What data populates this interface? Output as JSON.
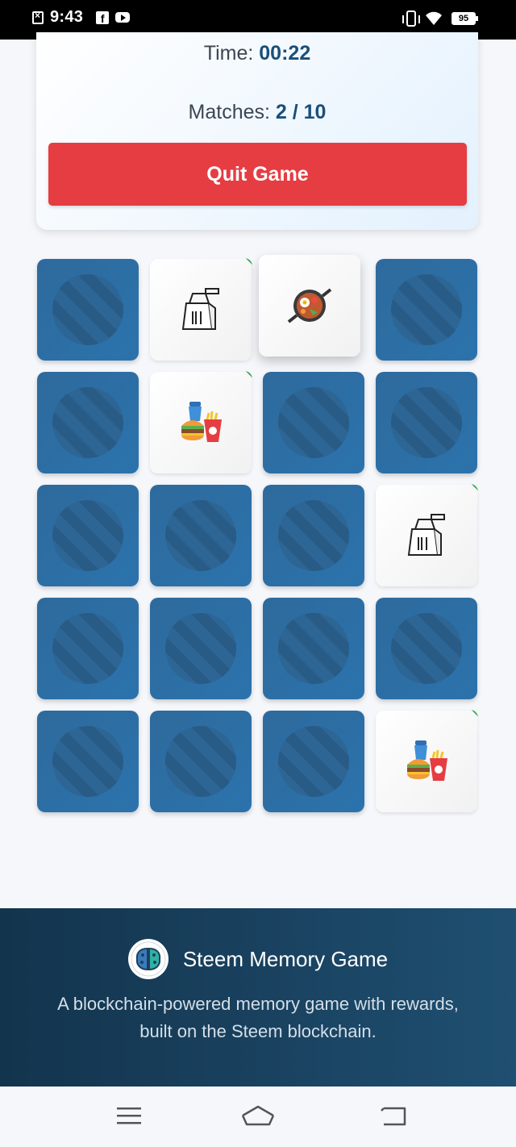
{
  "status_bar": {
    "time": "9:43",
    "battery": "95",
    "icons": [
      "notification-x-icon",
      "facebook-icon",
      "youtube-icon",
      "vibrate-icon",
      "wifi-icon",
      "battery-icon"
    ]
  },
  "stats": {
    "time_label": "Time: ",
    "time_value": "00:22",
    "matches_label": "Matches: ",
    "matches_value": "2 / 10",
    "quit_label": "Quit Game"
  },
  "board": {
    "columns": 4,
    "rows": 5,
    "cards": [
      {
        "state": "hidden"
      },
      {
        "state": "matched",
        "icon": "takeout-bag-icon"
      },
      {
        "state": "flipped",
        "icon": "food-pan-icon"
      },
      {
        "state": "hidden"
      },
      {
        "state": "hidden"
      },
      {
        "state": "matched",
        "icon": "fast-food-combo-icon"
      },
      {
        "state": "hidden"
      },
      {
        "state": "hidden"
      },
      {
        "state": "hidden"
      },
      {
        "state": "hidden"
      },
      {
        "state": "hidden"
      },
      {
        "state": "matched",
        "icon": "takeout-bag-icon"
      },
      {
        "state": "hidden"
      },
      {
        "state": "hidden"
      },
      {
        "state": "hidden"
      },
      {
        "state": "hidden"
      },
      {
        "state": "hidden"
      },
      {
        "state": "hidden"
      },
      {
        "state": "hidden"
      },
      {
        "state": "matched",
        "icon": "fast-food-combo-icon"
      }
    ],
    "colors": {
      "card_back": "#2b6a9c",
      "matched_indicator": "#2fa84f",
      "quit": "#e53d42"
    }
  },
  "footer": {
    "title": "Steem Memory Game",
    "description": "A blockchain-powered memory game with rewards, built on the Steem blockchain."
  },
  "nav": {
    "buttons": [
      "menu-icon",
      "home-icon",
      "back-icon"
    ]
  }
}
